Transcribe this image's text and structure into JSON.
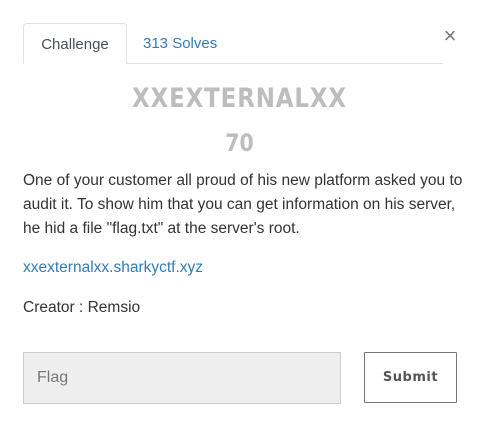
{
  "tabs": {
    "challenge_label": "Challenge",
    "solves_label": "313 Solves"
  },
  "close_label": "×",
  "challenge": {
    "name": "XXEXTERNALXX",
    "value": "70",
    "description": "One of your customer all proud of his new platform asked you to audit it. To show him that you can get information on his server, he hid a file \"flag.txt\" at the server's root.",
    "link": "xxexternalxx.sharkyctf.xyz",
    "creator": "Creator : Remsio"
  },
  "form": {
    "flag_placeholder": "Flag",
    "flag_value": "",
    "submit_label": "Submit"
  },
  "colors": {
    "link": "#337ab7",
    "title_gray": "#bdbdbd",
    "input_bg": "#eeeeee"
  }
}
